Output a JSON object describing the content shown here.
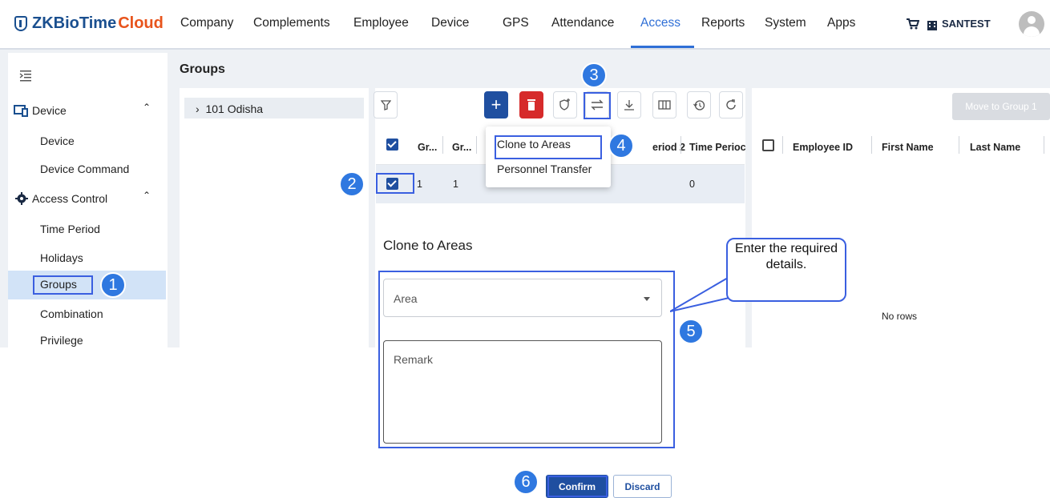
{
  "brand": {
    "zk": "ZKBioTime",
    "cloud": "Cloud"
  },
  "nav": {
    "items": [
      "Company",
      "Complements",
      "Employee",
      "Device",
      "GPS",
      "Attendance",
      "Access",
      "Reports",
      "System",
      "Apps"
    ],
    "active": "Access",
    "user": "SANTEST"
  },
  "sidebar": {
    "sections": [
      {
        "label": "Device",
        "icon": "device-icon",
        "children": [
          "Device",
          "Device Command"
        ]
      },
      {
        "label": "Access Control",
        "icon": "gear-icon",
        "children": [
          "Time Period",
          "Holidays",
          "Groups",
          "Combination",
          "Privilege"
        ]
      }
    ],
    "active": "Groups"
  },
  "page": {
    "title": "Groups"
  },
  "tree": {
    "item": "101 Odisha"
  },
  "toolbar": {
    "icons": [
      "filter-icon",
      "add-icon",
      "delete-icon",
      "verify-icon",
      "transfer-icon",
      "download-icon",
      "columns-icon",
      "history-icon",
      "refresh-icon"
    ],
    "move_label": "Move to Group 1"
  },
  "table": {
    "headers": [
      "Gr...",
      "Gr...",
      "eriod 2",
      "Time Perioc"
    ],
    "row": [
      "1",
      "1",
      "0"
    ]
  },
  "right_table": {
    "headers": [
      "Employee ID",
      "First Name",
      "Last Name"
    ],
    "empty": "No rows"
  },
  "dropdown": {
    "items": [
      "Clone to Areas",
      "Personnel Transfer"
    ]
  },
  "form": {
    "title": "Clone to Areas",
    "area_placeholder": "Area",
    "remark_placeholder": "Remark",
    "confirm": "Confirm",
    "discard": "Discard"
  },
  "annotations": {
    "badges": [
      "1",
      "2",
      "3",
      "4",
      "5",
      "6"
    ],
    "callout": "Enter the required details."
  },
  "colors": {
    "accent": "#2f6fd6",
    "primary": "#1f4fa0",
    "danger": "#d62b2b",
    "annotation": "#2f78e0",
    "brand_orange": "#e8541c"
  }
}
